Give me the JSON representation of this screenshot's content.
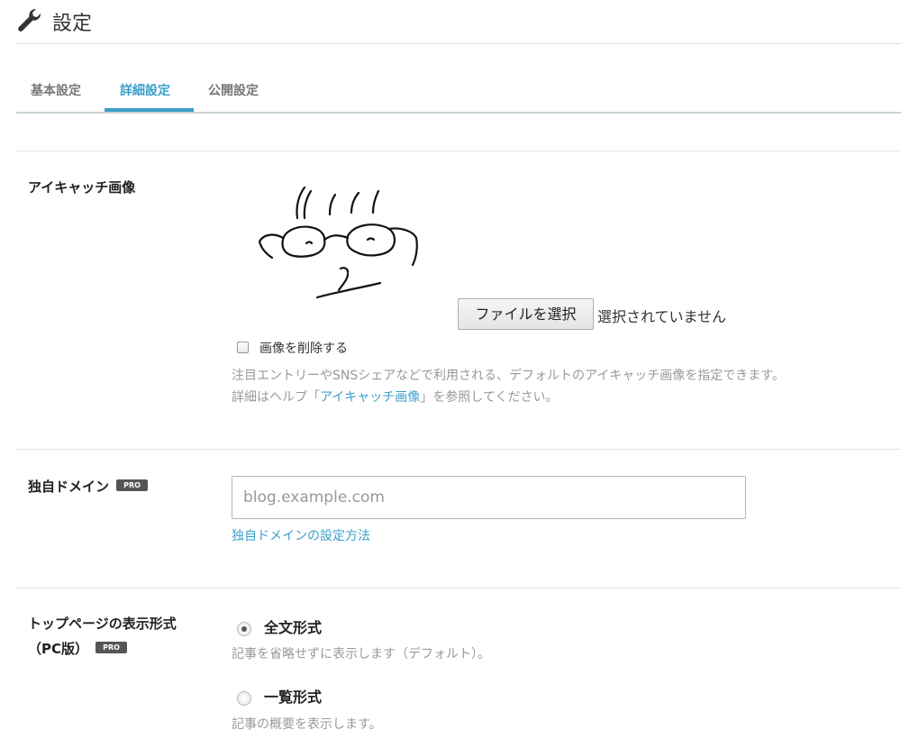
{
  "header": {
    "title": "設定",
    "icon": "wrench-icon"
  },
  "tabs": [
    {
      "label": "基本設定",
      "active": false
    },
    {
      "label": "詳細設定",
      "active": true
    },
    {
      "label": "公開設定",
      "active": false
    }
  ],
  "eyecatch": {
    "label": "アイキャッチ画像",
    "file_button": "ファイルを選択",
    "file_status": "選択されていません",
    "delete_label": "画像を削除する",
    "help_line1": "注目エントリーやSNSシェアなどで利用される、デフォルトのアイキャッチ画像を指定できます。",
    "help_prefix": "詳細はヘルプ「",
    "help_link": "アイキャッチ画像",
    "help_suffix": "」を参照してください。"
  },
  "domain": {
    "label": "独自ドメイン",
    "badge": "PRO",
    "placeholder": "blog.example.com",
    "link": "独自ドメインの設定方法"
  },
  "display": {
    "label_line1": "トップページの表示形式",
    "label_line2": "（PC版）",
    "badge": "PRO",
    "options": [
      {
        "label": "全文形式",
        "description": "記事を省略せずに表示します（デフォルト）。",
        "checked": true
      },
      {
        "label": "一覧形式",
        "description": "記事の概要を表示します。",
        "checked": false
      }
    ]
  },
  "colors": {
    "accent": "#3b9fc9",
    "muted": "#999999",
    "badge": "#555555"
  }
}
